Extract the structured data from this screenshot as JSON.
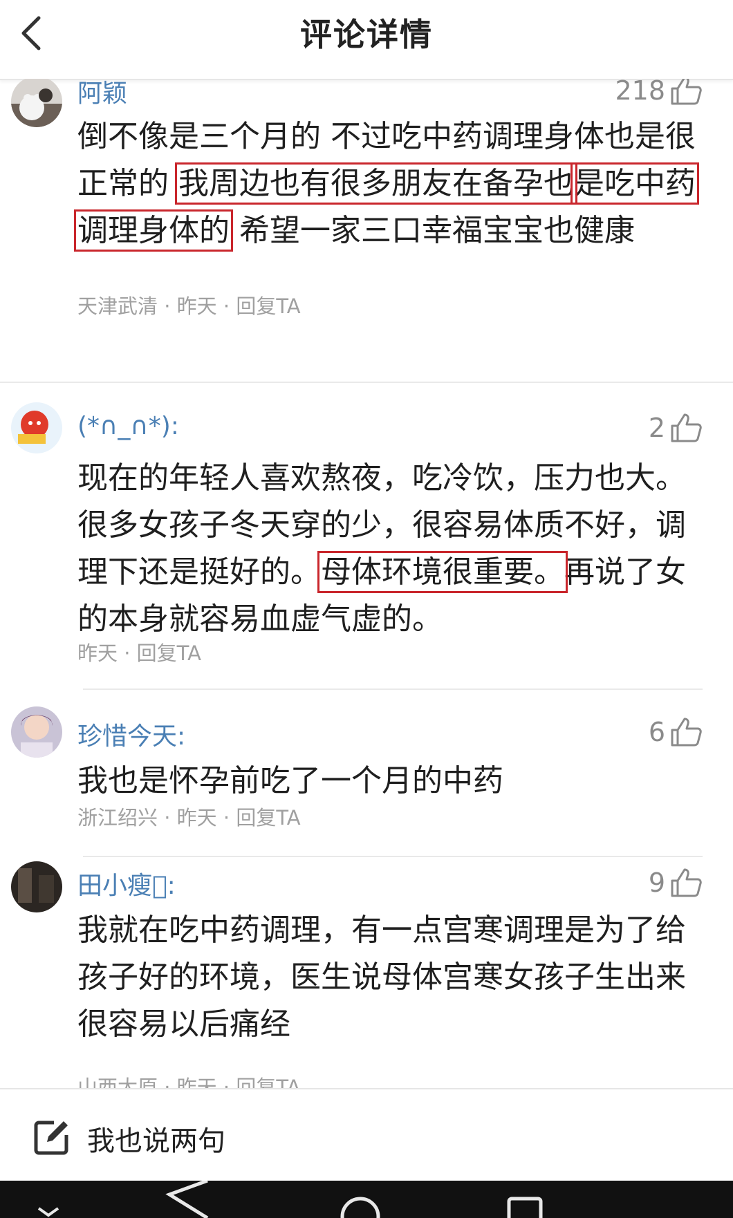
{
  "header": {
    "title": "评论详情"
  },
  "comments": [
    {
      "name": "阿颖",
      "likes": "218",
      "text_a": "倒不像是三个月的 不过吃中药调理身体也是很正常的 ",
      "text_hl1": "我周边也有很多朋友在备孕也",
      "text_hl2": "是吃中药调理身体的",
      "text_b": " 希望一家三口幸福宝宝也健康",
      "location": "天津武清",
      "time": "昨天",
      "reply": "回复TA"
    },
    {
      "name": "(*∩_∩*):",
      "likes": "2",
      "text_a": "现在的年轻人喜欢熬夜，吃冷饮，压力也大。很多女孩子冬天穿的少，很容易体质不好，调理下还是挺好的。",
      "text_hl1": "母体环境很重要。",
      "text_b": "再说了女的本身就容易血虚气虚的。",
      "time": "昨天",
      "reply": "回复TA"
    },
    {
      "name": "珍惜今天:",
      "likes": "6",
      "text_a": "我也是怀孕前吃了一个月的中药",
      "location": "浙江绍兴",
      "time": "昨天",
      "reply": "回复TA"
    },
    {
      "name": "田小瘦\u0000:",
      "likes": "9",
      "text_a": "我就在吃中药调理，有一点宫寒调理是为了给孩子好的环境，医生说母体宫寒女孩子生出来很容易以后痛经",
      "location": "山西太原",
      "time": "昨天",
      "reply": "回复TA"
    }
  ],
  "sep": "·",
  "bottom": {
    "input_label": "我也说两句"
  },
  "icons": {
    "back": "chevron-left-icon",
    "like": "thumb-up-icon",
    "edit": "edit-icon",
    "nav_back": "triangle-back-icon",
    "nav_home": "circle-home-icon",
    "nav_recent": "square-recent-icon"
  },
  "colors": {
    "name": "#4a7fb4",
    "highlight_box": "#c9262c",
    "meta": "#a0a0a0"
  }
}
